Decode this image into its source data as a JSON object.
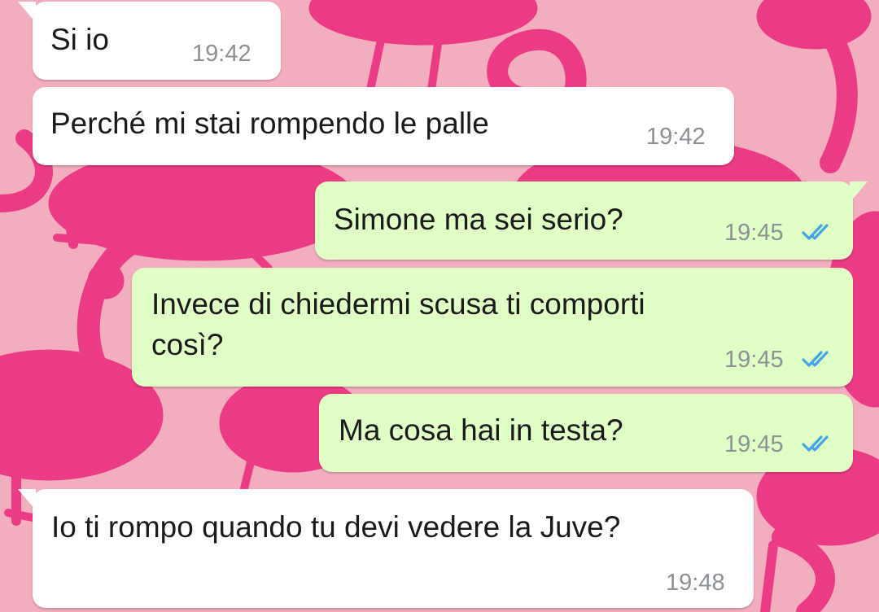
{
  "theme": {
    "wallpaper_bg": "#f2aebe",
    "flamingo_color": "#ec3b85",
    "incoming_bubble": "#ffffff",
    "outgoing_bubble": "#e1fec7",
    "read_tick_color": "#3fa7e6",
    "timestamp_color": "#8c9196"
  },
  "messages": [
    {
      "direction": "incoming",
      "text": "Si io",
      "time": "19:42"
    },
    {
      "direction": "incoming",
      "text": "Perché mi stai rompendo le palle",
      "time": "19:42"
    },
    {
      "direction": "outgoing",
      "text": "Simone ma sei serio?",
      "time": "19:45",
      "status_icon": "double-check-read-icon"
    },
    {
      "direction": "outgoing",
      "text": "Invece di chiedermi scusa ti comporti\ncosì?",
      "time": "19:45",
      "status_icon": "double-check-read-icon"
    },
    {
      "direction": "outgoing",
      "text": "Ma cosa hai in testa?",
      "time": "19:45",
      "status_icon": "double-check-read-icon"
    },
    {
      "direction": "incoming",
      "text": "Io ti rompo quando tu devi vedere la Juve?",
      "time": "19:48"
    }
  ]
}
